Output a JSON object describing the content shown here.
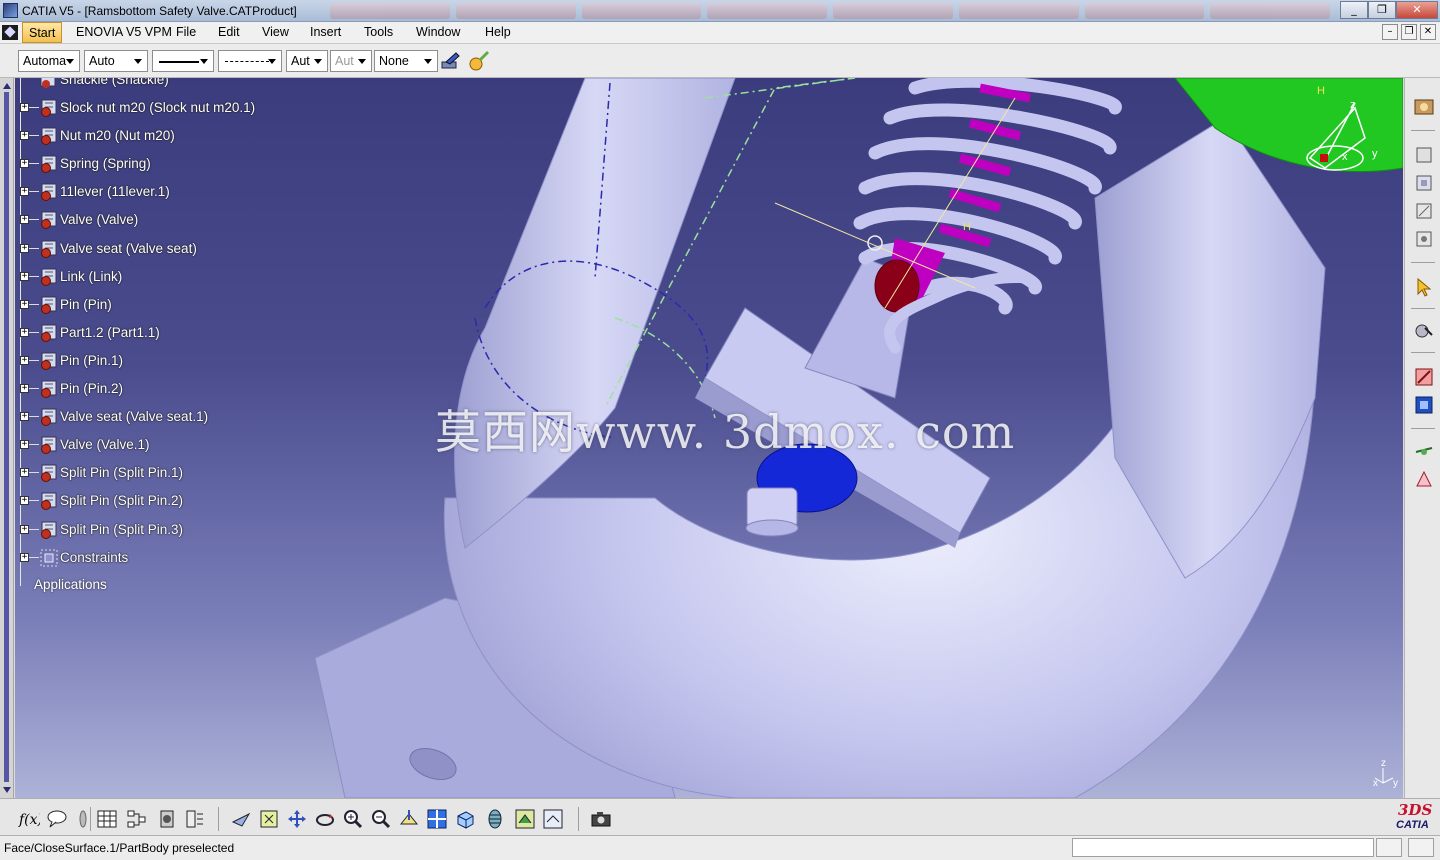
{
  "window": {
    "title": "CATIA V5 - [Ramsbottom Safety Valve.CATProduct]",
    "minimize": "_",
    "restore": "❐",
    "close": "✕"
  },
  "menu": {
    "start": "Start",
    "items": [
      "ENOVIA V5 VPM",
      "File",
      "Edit",
      "View",
      "Insert",
      "Tools",
      "Window",
      "Help"
    ]
  },
  "properties_toolbar": {
    "fill_color": "Automa",
    "transparency": "Auto",
    "layer_value": "Aut",
    "layer_disabled": "Aut",
    "rendering_style": "None"
  },
  "tree": {
    "partial_top": "Shackle (Shackle)",
    "items": [
      "Slock nut m20 (Slock nut m20.1)",
      "Nut m20 (Nut m20)",
      "Spring (Spring)",
      "11lever (11lever.1)",
      "Valve (Valve)",
      "Valve seat (Valve seat)",
      "Link (Link)",
      "Pin (Pin)",
      "Part1.2 (Part1.1)",
      "Pin (Pin.1)",
      "Pin (Pin.2)",
      "Valve seat (Valve seat.1)",
      "Valve (Valve.1)",
      "Split Pin (Split Pin.1)",
      "Split Pin (Split Pin.2)",
      "Split Pin (Split Pin.3)"
    ],
    "constraints": "Constraints",
    "applications": "Applications"
  },
  "viewport": {
    "watermark": "莫西网www. 3dmox. com",
    "compass_axes": {
      "x": "x",
      "y": "y",
      "z": "z"
    },
    "small_axis": {
      "z": "z",
      "x": "x",
      "y": "y"
    },
    "sketch_labels": [
      "H",
      "H"
    ]
  },
  "brand": {
    "ds": "3DS",
    "name": "CATIA"
  },
  "status": {
    "message": "Face/CloseSurface.1/PartBody preselected"
  },
  "colors": {
    "viewport_top": "#3b3c7d",
    "viewport_bottom": "#adb2d8",
    "part_body": "#c6c7ef",
    "spring_highlight": "#c000c0",
    "nut_blue": "#1428d8",
    "flange_green": "#22c822"
  }
}
